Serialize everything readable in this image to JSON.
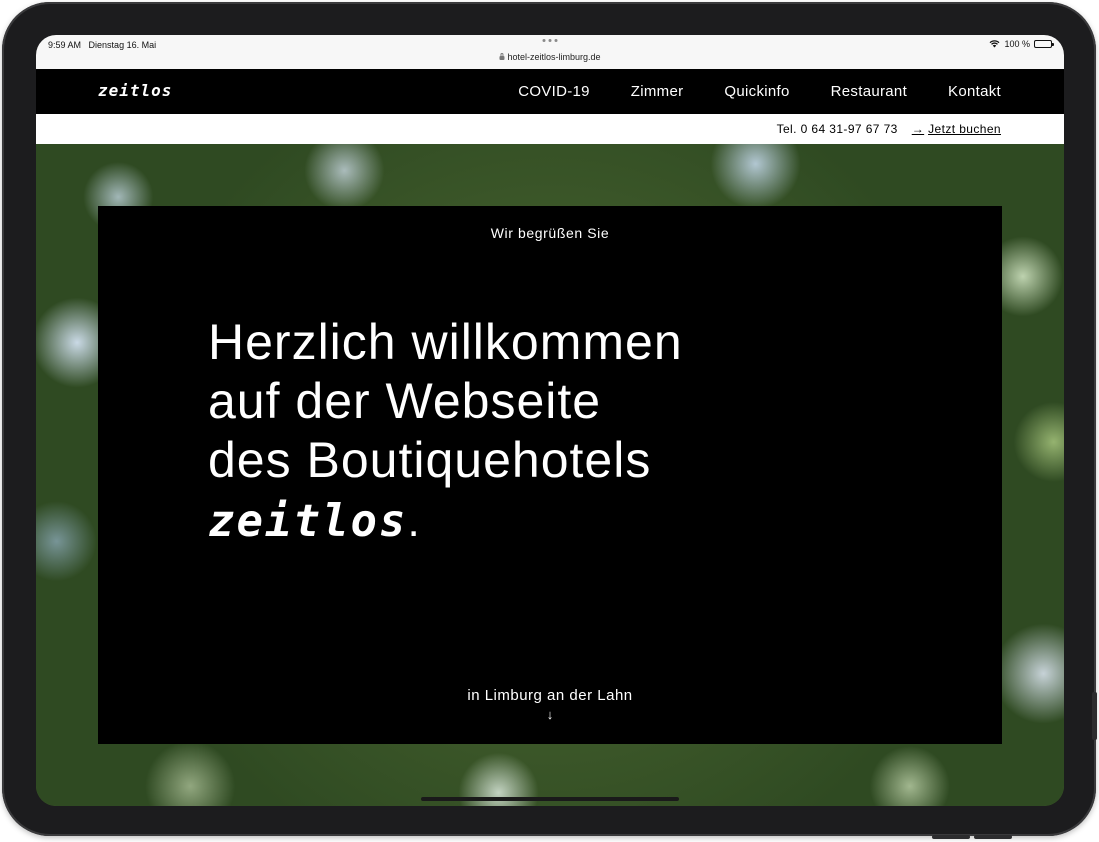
{
  "status": {
    "time": "9:59 AM",
    "date": "Dienstag 16. Mai",
    "battery": "100 %"
  },
  "browser": {
    "url": "hotel-zeitlos-limburg.de"
  },
  "nav": {
    "logo": "zeitlos",
    "links": [
      "COVID-19",
      "Zimmer",
      "Quickinfo",
      "Restaurant",
      "Kontakt"
    ]
  },
  "contact": {
    "phone": "Tel. 0 64 31-97 67 73",
    "book_arrow": "→",
    "book_label": "Jetzt buchen"
  },
  "hero": {
    "greeting": "Wir begrüßen Sie",
    "headline_lines": [
      "Herzlich willkommen",
      "auf der Webseite",
      "des Boutiquehotels"
    ],
    "brand": "zeitlos",
    "brand_dot": ".",
    "location": "in Limburg an der Lahn",
    "scroll_arrow": "↓"
  }
}
